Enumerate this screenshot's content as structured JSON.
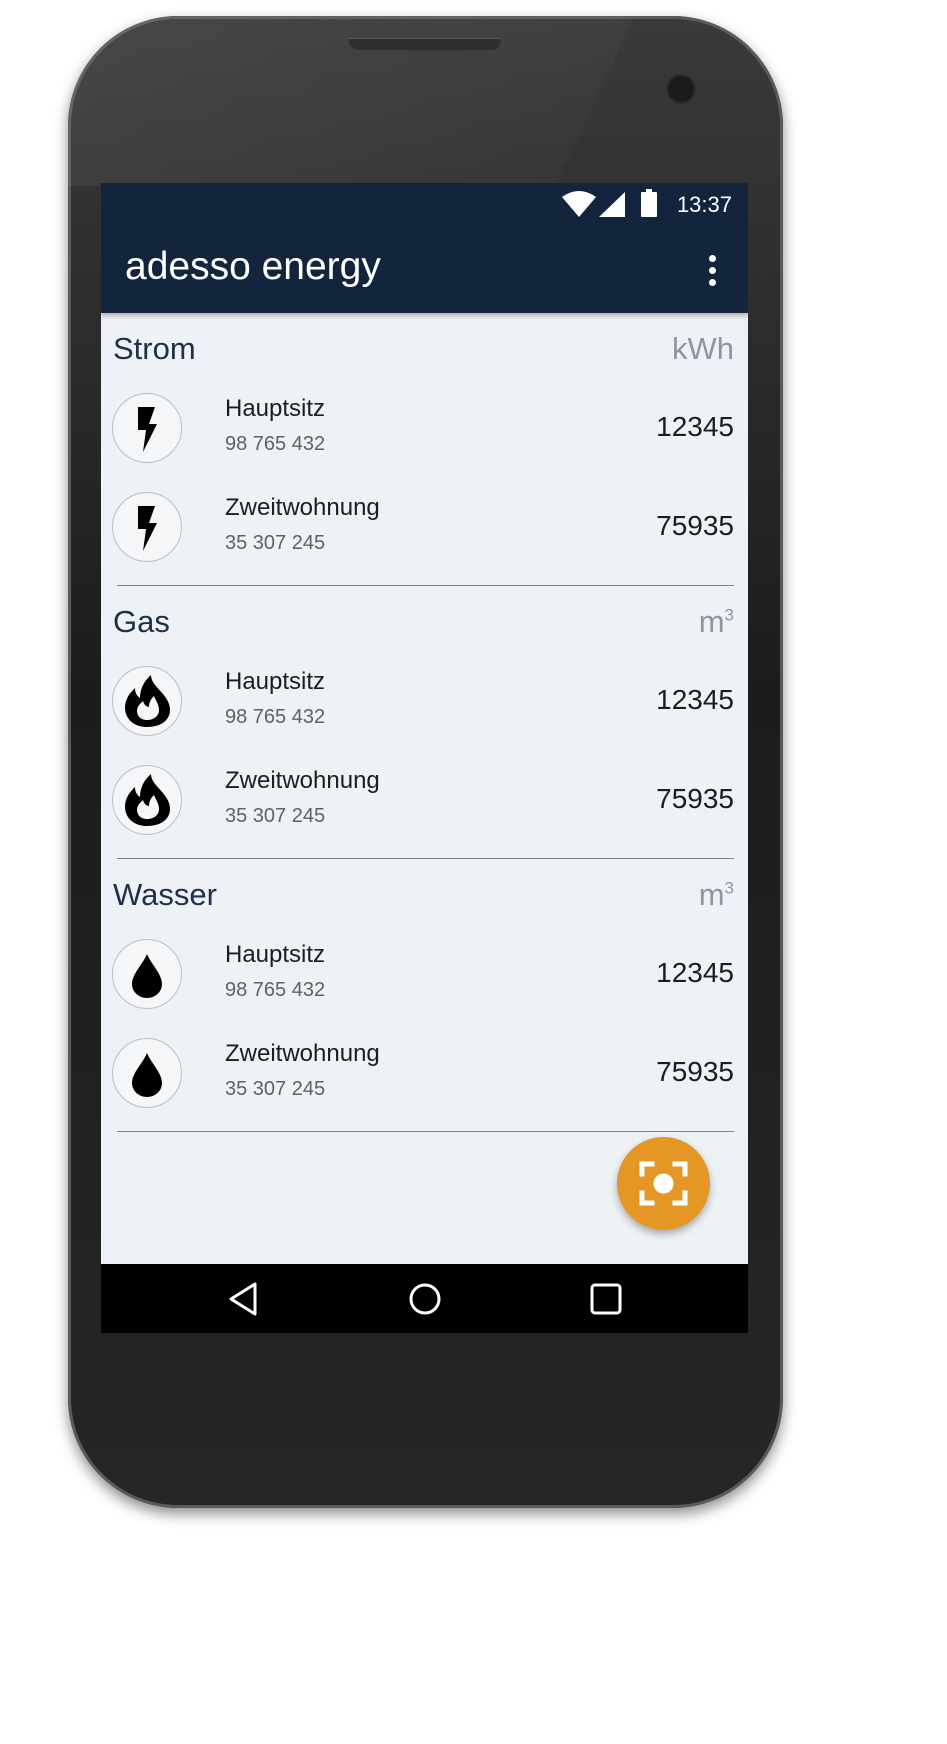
{
  "status_bar": {
    "time": "13:37",
    "icons": [
      "wifi-icon",
      "signal-icon",
      "battery-icon"
    ]
  },
  "app_bar": {
    "title": "adesso energy",
    "menu_icon": "more-vert-icon"
  },
  "colors": {
    "app_bar": "#12253d",
    "background": "#eef1f5",
    "fab": "#e49724",
    "section_title": "#1f3148",
    "unit": "#8d96a3"
  },
  "sections": [
    {
      "title": "Strom",
      "unit": "kWh",
      "unit_sup": "",
      "icon": "lightning-bolt-icon",
      "meters": [
        {
          "name": "Hauptsitz",
          "number": "98 765 432",
          "value": "12345"
        },
        {
          "name": "Zweitwohnung",
          "number": "35 307 245",
          "value": "75935"
        }
      ]
    },
    {
      "title": "Gas",
      "unit": "m",
      "unit_sup": "3",
      "icon": "flame-icon",
      "meters": [
        {
          "name": "Hauptsitz",
          "number": "98 765 432",
          "value": "12345"
        },
        {
          "name": "Zweitwohnung",
          "number": "35 307 245",
          "value": "75935"
        }
      ]
    },
    {
      "title": "Wasser",
      "unit": "m",
      "unit_sup": "3",
      "icon": "water-drop-icon",
      "meters": [
        {
          "name": "Hauptsitz",
          "number": "98 765 432",
          "value": "12345"
        },
        {
          "name": "Zweitwohnung",
          "number": "35 307 245",
          "value": "75935"
        }
      ]
    }
  ],
  "fab": {
    "icon": "scan-camera-icon"
  },
  "nav_bar": {
    "buttons": [
      "back-icon",
      "home-icon",
      "recents-icon"
    ]
  }
}
